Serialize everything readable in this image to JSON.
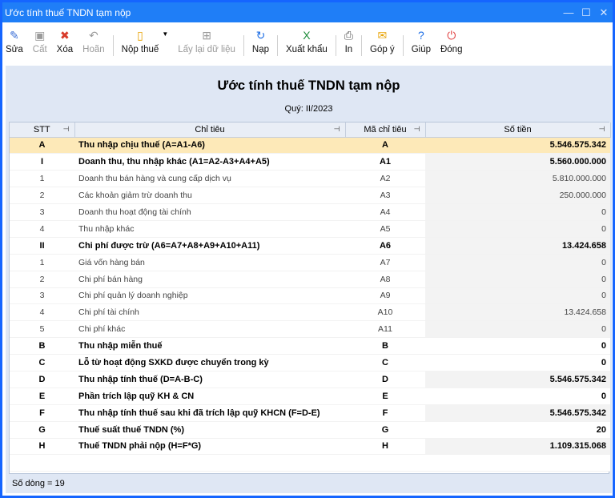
{
  "window": {
    "title": "Ước tính thuế TNDN tạm nộp",
    "min": "—",
    "max": "☐",
    "close": "✕"
  },
  "toolbar": [
    {
      "key": "sua",
      "label": "Sửa",
      "icon": "✎",
      "color": "#3b6fd6",
      "disabled": false
    },
    {
      "key": "cat",
      "label": "Cất",
      "icon": "▣",
      "color": "#9a9a9a",
      "disabled": true
    },
    {
      "key": "xoa",
      "label": "Xóa",
      "icon": "✖",
      "color": "#d83b2b",
      "disabled": false
    },
    {
      "key": "hoan",
      "label": "Hoãn",
      "icon": "↶",
      "color": "#9a9a9a",
      "disabled": true
    },
    {
      "key": "nopthue",
      "label": "Nộp thuế",
      "icon": "▯",
      "color": "#e8a200",
      "disabled": false,
      "dropdown": true
    },
    {
      "key": "laylai",
      "label": "Lấy lại dữ liệu",
      "icon": "⊞",
      "color": "#9a9a9a",
      "disabled": true
    },
    {
      "key": "nap",
      "label": "Nạp",
      "icon": "↻",
      "color": "#1f6fe5",
      "disabled": false
    },
    {
      "key": "xuatkhau",
      "label": "Xuất khẩu",
      "icon": "X",
      "color": "#1e8c3a",
      "disabled": false
    },
    {
      "key": "in",
      "label": "In",
      "icon": "⎙",
      "color": "#555",
      "disabled": false
    },
    {
      "key": "gopy",
      "label": "Góp ý",
      "icon": "✉",
      "color": "#e8a200",
      "disabled": false
    },
    {
      "key": "giup",
      "label": "Giúp",
      "icon": "?",
      "color": "#1f6fe5",
      "disabled": false
    },
    {
      "key": "dong",
      "label": "Đóng",
      "icon": "⏻",
      "color": "#e03a3a",
      "disabled": false
    }
  ],
  "heading": "Ước tính thuế TNDN tạm nộp",
  "period": "Quý: II/2023",
  "columns": {
    "stt": "STT",
    "chitieu": "Chỉ tiêu",
    "ma": "Mã chỉ tiêu",
    "sotien": "Số tiền"
  },
  "rows": [
    {
      "stt": "A",
      "name": "Thu nhập chịu thuế (A=A1-A6)",
      "code": "A",
      "amount": "5.546.575.342",
      "bold": true,
      "selected": true
    },
    {
      "stt": "I",
      "name": "Doanh thu, thu nhập khác (A1=A2-A3+A4+A5)",
      "code": "A1",
      "amount": "5.560.000.000",
      "bold": true
    },
    {
      "stt": "1",
      "name": "Doanh thu bán hàng và cung cấp dịch vụ",
      "code": "A2",
      "amount": "5.810.000.000",
      "bold": false
    },
    {
      "stt": "2",
      "name": "Các khoản giảm trừ doanh thu",
      "code": "A3",
      "amount": "250.000.000",
      "bold": false
    },
    {
      "stt": "3",
      "name": "Doanh thu hoạt động tài chính",
      "code": "A4",
      "amount": "0",
      "bold": false
    },
    {
      "stt": "4",
      "name": "Thu nhập khác",
      "code": "A5",
      "amount": "0",
      "bold": false
    },
    {
      "stt": "II",
      "name": "Chi phí được trừ (A6=A7+A8+A9+A10+A11)",
      "code": "A6",
      "amount": "13.424.658",
      "bold": true
    },
    {
      "stt": "1",
      "name": "Giá vốn hàng bán",
      "code": "A7",
      "amount": "0",
      "bold": false
    },
    {
      "stt": "2",
      "name": "Chi phí bán hàng",
      "code": "A8",
      "amount": "0",
      "bold": false
    },
    {
      "stt": "3",
      "name": "Chi phí quản lý doanh nghiệp",
      "code": "A9",
      "amount": "0",
      "bold": false
    },
    {
      "stt": "4",
      "name": "Chi phí tài chính",
      "code": "A10",
      "amount": "13.424.658",
      "bold": false
    },
    {
      "stt": "5",
      "name": "Chi phí khác",
      "code": "A11",
      "amount": "0",
      "bold": false
    },
    {
      "stt": "B",
      "name": "Thu nhập miễn thuế",
      "code": "B",
      "amount": "0",
      "bold": true,
      "editable": true
    },
    {
      "stt": "C",
      "name": "Lỗ từ hoạt động SXKD được chuyển trong kỳ",
      "code": "C",
      "amount": "0",
      "bold": true,
      "editable": true
    },
    {
      "stt": "D",
      "name": "Thu nhập tính thuế (D=A-B-C)",
      "code": "D",
      "amount": "5.546.575.342",
      "bold": true
    },
    {
      "stt": "E",
      "name": "Phần trích lập quỹ KH & CN",
      "code": "E",
      "amount": "0",
      "bold": true,
      "editable": true
    },
    {
      "stt": "F",
      "name": "Thu nhập tính thuế sau khi đã trích lập quỹ KHCN (F=D-E)",
      "code": "F",
      "amount": "5.546.575.342",
      "bold": true
    },
    {
      "stt": "G",
      "name": "Thuế suất thuế TNDN (%)",
      "code": "G",
      "amount": "20",
      "bold": true,
      "editable": true
    },
    {
      "stt": "H",
      "name": "Thuế TNDN phải nộp (H=F*G)",
      "code": "H",
      "amount": "1.109.315.068",
      "bold": true
    }
  ],
  "footer": "Số dòng = 19"
}
